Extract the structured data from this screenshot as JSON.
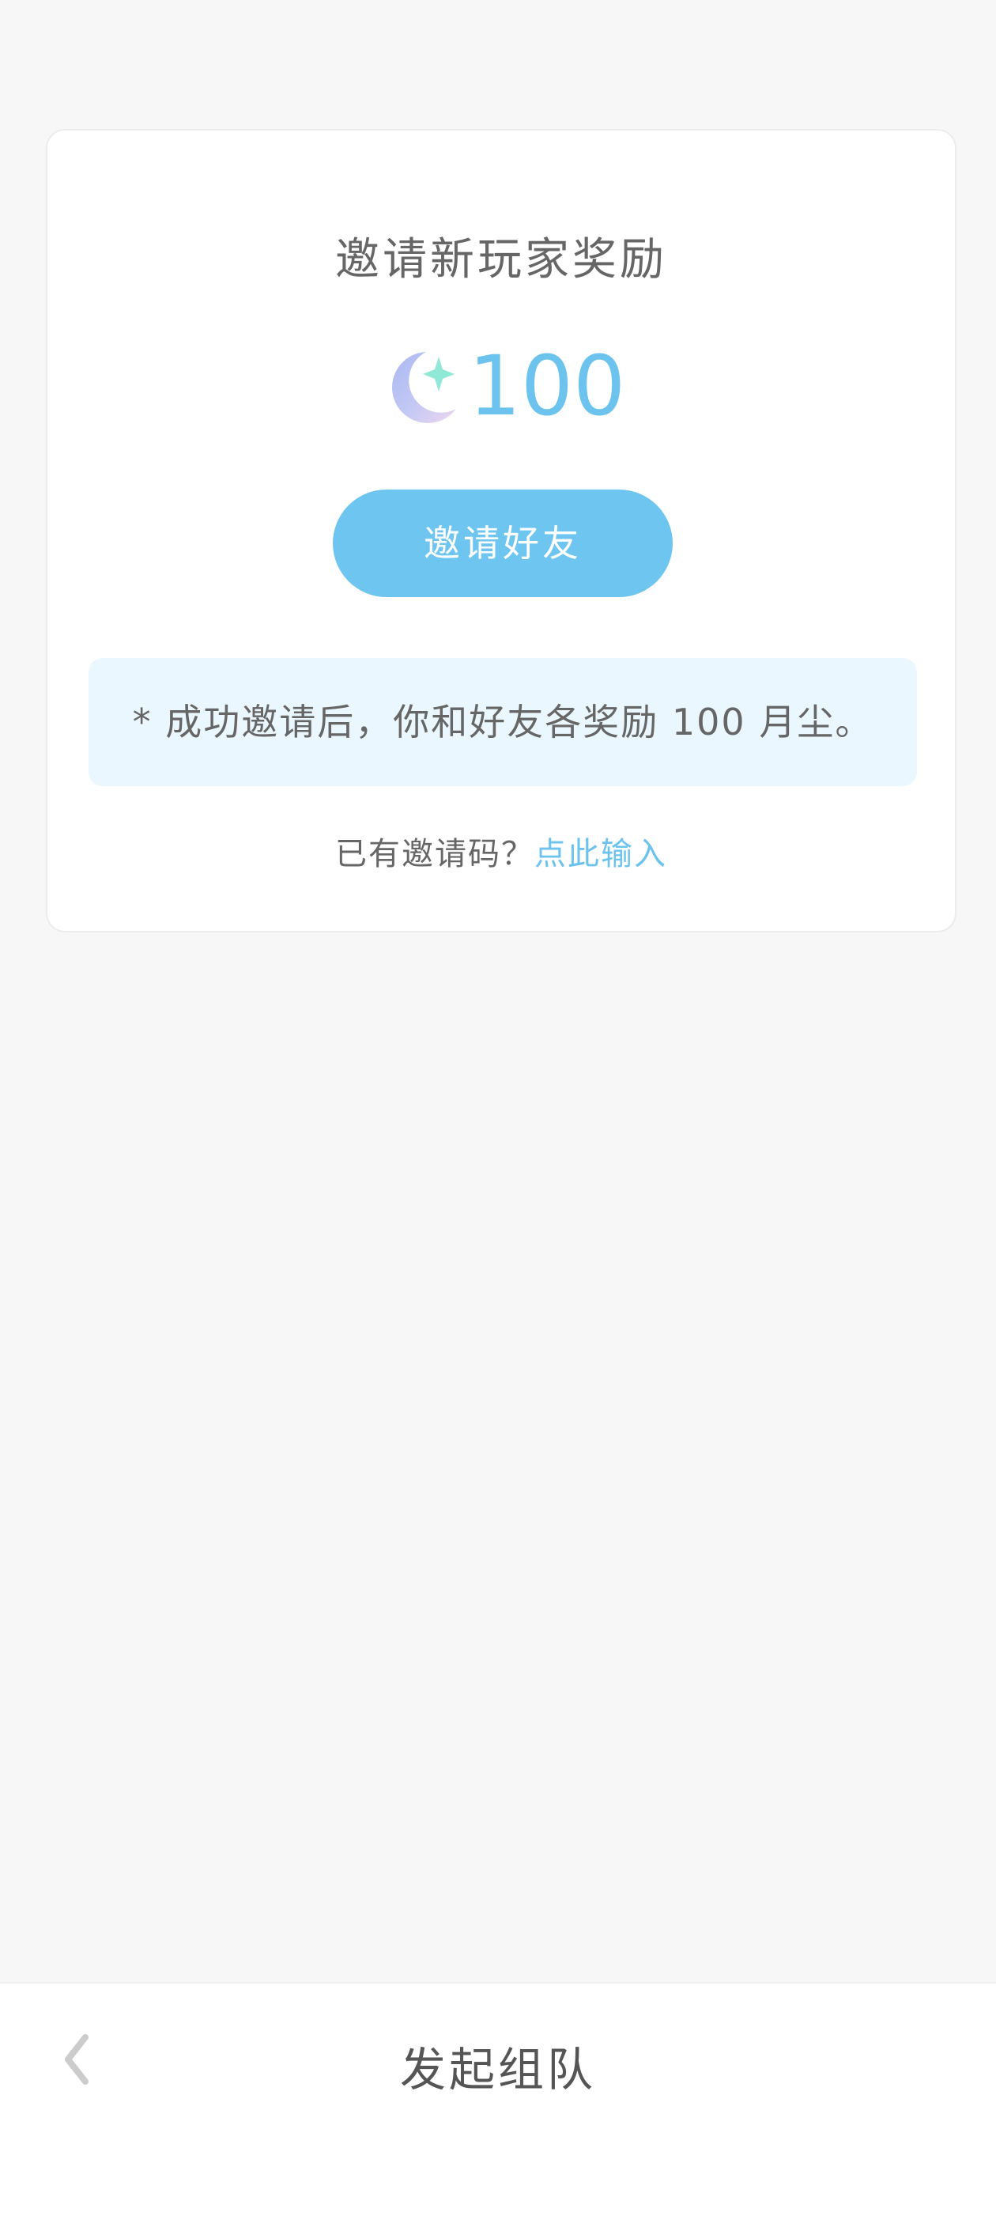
{
  "card": {
    "title": "邀请新玩家奖励",
    "reward_icon": "moon-star-icon",
    "reward_amount": "100",
    "invite_button_label": "邀请好友",
    "notice": "* 成功邀请后，你和好友各奖励 100 月尘。",
    "code_prompt": "已有邀请码？",
    "code_link": "点此输入"
  },
  "bottom_bar": {
    "back_icon": "chevron-left-icon",
    "title": "发起组队"
  },
  "colors": {
    "background": "#f7f7f7",
    "accent": "#6cc3ed",
    "button": "#6ec5ef",
    "notice_bg": "#eaf7fe",
    "text": "#666666"
  }
}
